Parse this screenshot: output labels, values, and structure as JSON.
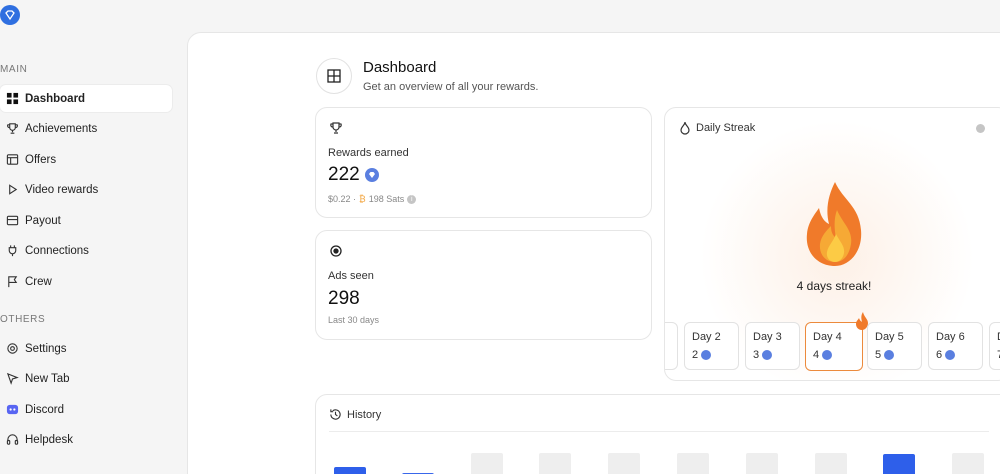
{
  "sidebar": {
    "sections": [
      {
        "label": "MAIN",
        "items": [
          {
            "label": "Dashboard",
            "icon": "grid-icon",
            "active": true
          },
          {
            "label": "Achievements",
            "icon": "trophy-icon"
          },
          {
            "label": "Offers",
            "icon": "browser-icon"
          },
          {
            "label": "Video rewards",
            "icon": "play-icon"
          },
          {
            "label": "Payout",
            "icon": "wallet-icon"
          },
          {
            "label": "Connections",
            "icon": "plug-icon"
          },
          {
            "label": "Crew",
            "icon": "flag-icon"
          }
        ]
      },
      {
        "label": "OTHERS",
        "items": [
          {
            "label": "Settings",
            "icon": "gear-icon"
          },
          {
            "label": "New Tab",
            "icon": "cursor-icon"
          },
          {
            "label": "Discord",
            "icon": "discord-icon"
          },
          {
            "label": "Helpdesk",
            "icon": "headset-icon"
          }
        ]
      }
    ]
  },
  "header": {
    "title": "Dashboard",
    "subtitle": "Get an overview of all your rewards."
  },
  "rewards": {
    "label": "Rewards earned",
    "value": "222",
    "usd": "$0.22 ·",
    "sats": "198 Sats"
  },
  "ads": {
    "label": "Ads seen",
    "value": "298",
    "period": "Last 30 days"
  },
  "streak": {
    "title": "Daily Streak",
    "message": "4 days streak!",
    "days": [
      {
        "name": "Day 2",
        "value": "2"
      },
      {
        "name": "Day 3",
        "value": "3"
      },
      {
        "name": "Day 4",
        "value": "4",
        "current": true
      },
      {
        "name": "Day 5",
        "value": "5"
      },
      {
        "name": "Day 6",
        "value": "6"
      },
      {
        "name": "D",
        "value": "7"
      }
    ]
  },
  "history": {
    "title": "History"
  },
  "colors": {
    "accent": "#2e5fea",
    "streak": "#ec8a3c",
    "gem": "#5a7fe0"
  }
}
